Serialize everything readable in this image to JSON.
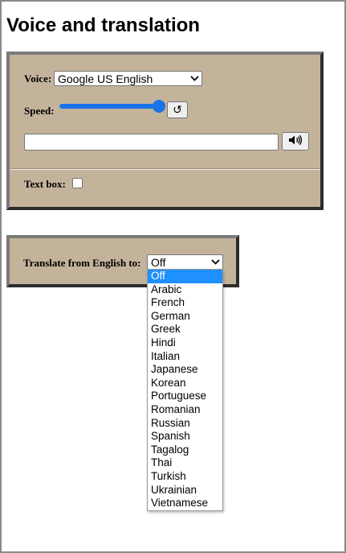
{
  "page": {
    "title": "Voice and translation"
  },
  "voice_panel": {
    "voice_label": "Voice:",
    "voice_selected": "Google US English",
    "speed_label": "Speed:",
    "speed_value_fraction": 1.0,
    "reset_button_symbol": "↺",
    "reset_button_icon": "reset-icon",
    "text_input_value": "",
    "speak_button_icon": "speaker-icon",
    "textbox_label": "Text box:",
    "textbox_checked": false
  },
  "translate_panel": {
    "label": "Translate from English to:",
    "selected": "Off",
    "options": [
      "Off",
      "Arabic",
      "French",
      "German",
      "Greek",
      "Hindi",
      "Italian",
      "Japanese",
      "Korean",
      "Portuguese",
      "Romanian",
      "Russian",
      "Spanish",
      "Tagalog",
      "Thai",
      "Turkish",
      "Ukrainian",
      "Vietnamese"
    ],
    "highlighted_index": 0
  },
  "colors": {
    "panel_bg": "#c4b39b",
    "accent": "#1a73e8",
    "highlight": "#1e90ff"
  }
}
